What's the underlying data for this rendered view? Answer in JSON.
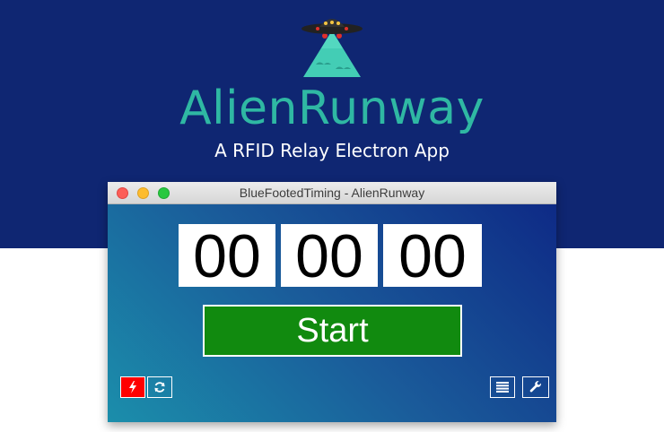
{
  "page": {
    "app_name": "AlienRunway",
    "tagline": "A RFID Relay Electron App"
  },
  "window": {
    "title": "BlueFootedTiming - AlienRunway"
  },
  "timer": {
    "hours": "00",
    "minutes": "00",
    "seconds": "00"
  },
  "controls": {
    "start_label": "Start"
  },
  "icons": {
    "logo": "ufo-mountain-logo",
    "power": "bolt-icon",
    "refresh": "refresh-icon",
    "list": "list-icon",
    "settings": "wrench-icon"
  },
  "colors": {
    "banner_bg": "#0f2672",
    "brand_teal": "#2fb8a3",
    "start_green": "#118a0f",
    "alert_red": "#ff0000"
  }
}
